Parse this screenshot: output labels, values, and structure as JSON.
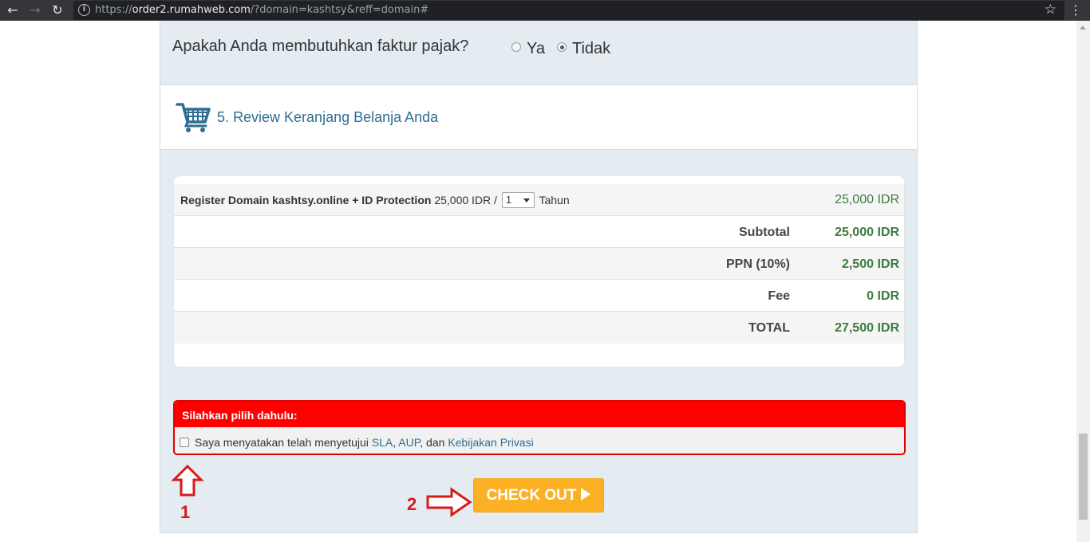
{
  "browser": {
    "url_prefix": "https://",
    "url_host": "order2.rumahweb.com",
    "url_path": "/?domain=kashtsy&reff=domain#"
  },
  "tax_question": {
    "label": "Apakah Anda membutuhkan faktur pajak?",
    "options": [
      {
        "label": "Ya",
        "selected": false
      },
      {
        "label": "Tidak",
        "selected": true
      }
    ]
  },
  "section": {
    "title": "5. Review Keranjang Belanja Anda",
    "icon": "shopping-cart-icon"
  },
  "cart": {
    "item": {
      "name": "Register Domain kashtsy.online + ID Protection",
      "unit_price": "25,000 IDR /",
      "quantity": "1",
      "unit": "Tahun",
      "price": "25,000 IDR"
    },
    "summary": [
      {
        "label": "Subtotal",
        "value": "25,000 IDR"
      },
      {
        "label": "PPN (10%)",
        "value": "2,500 IDR"
      },
      {
        "label": "Fee",
        "value": "0 IDR"
      },
      {
        "label": "TOTAL",
        "value": "27,500 IDR"
      }
    ]
  },
  "agreement": {
    "header": "Silahkan pilih dahulu:",
    "text_before": "Saya menyatakan telah menyetujui",
    "link_sla": "SLA",
    "separator": ",",
    "link_aup": "AUP",
    "text_and": ", dan",
    "link_privacy": "Kebijakan Privasi",
    "checked": false
  },
  "checkout": {
    "label": "CHECK OUT"
  },
  "annotations": {
    "step1": "1",
    "step2": "2"
  },
  "colors": {
    "accent_blue": "#2f6e92",
    "price_green": "#3f7a3f",
    "alert_red": "#ff0000",
    "checkout_orange": "#fcb124",
    "annotation_red": "#d91a1a"
  }
}
